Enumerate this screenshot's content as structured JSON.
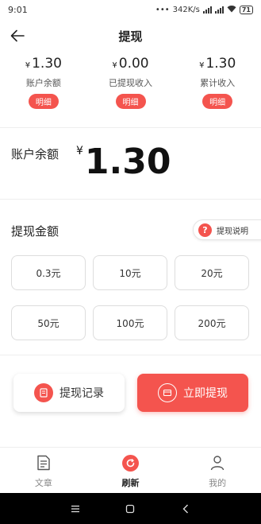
{
  "status_bar": {
    "time": "9:01",
    "network_speed": "342K/s",
    "battery": "71"
  },
  "header": {
    "title": "提现"
  },
  "stats": [
    {
      "currency": "¥",
      "value": "1.30",
      "label": "账户余额",
      "button": "明细"
    },
    {
      "currency": "¥",
      "value": "0.00",
      "label": "已提现收入",
      "button": "明细"
    },
    {
      "currency": "¥",
      "value": "1.30",
      "label": "累计收入",
      "button": "明细"
    }
  ],
  "balance": {
    "label": "账户余额",
    "currency": "¥",
    "amount": "1.30"
  },
  "withdraw_amount": {
    "label": "提现金额",
    "help_label": "提现说明",
    "options": [
      "0.3元",
      "10元",
      "20元",
      "50元",
      "100元",
      "200元"
    ]
  },
  "actions": {
    "records_label": "提现记录",
    "withdraw_label": "立即提现"
  },
  "tabbar": {
    "items": [
      {
        "label": "文章",
        "icon": "article-icon"
      },
      {
        "label": "刷新",
        "icon": "refresh-icon",
        "active": true
      },
      {
        "label": "我的",
        "icon": "profile-icon"
      }
    ]
  },
  "colors": {
    "accent": "#f4544e"
  }
}
